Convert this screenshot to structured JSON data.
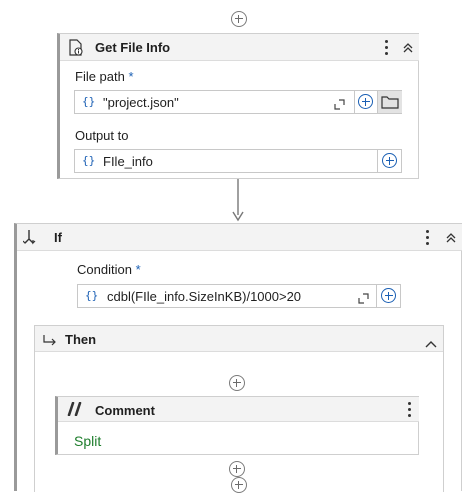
{
  "get_file_info": {
    "title": "Get File Info",
    "file_path_label": "File path",
    "required_mark": "*",
    "file_path_value": "\"project.json\"",
    "output_label": "Output to",
    "output_value": "FIle_info",
    "braces": "{}"
  },
  "if_block": {
    "title": "If",
    "condition_label": "Condition",
    "required_mark": "*",
    "condition_value": "cdbl(FIle_info.SizeInKB)/1000>20",
    "braces": "{}",
    "then_label": "Then"
  },
  "comment": {
    "title": "Comment",
    "text": "Split"
  },
  "colors": {
    "accent": "#1a5fb4",
    "comment_text": "#1e7d2c"
  }
}
